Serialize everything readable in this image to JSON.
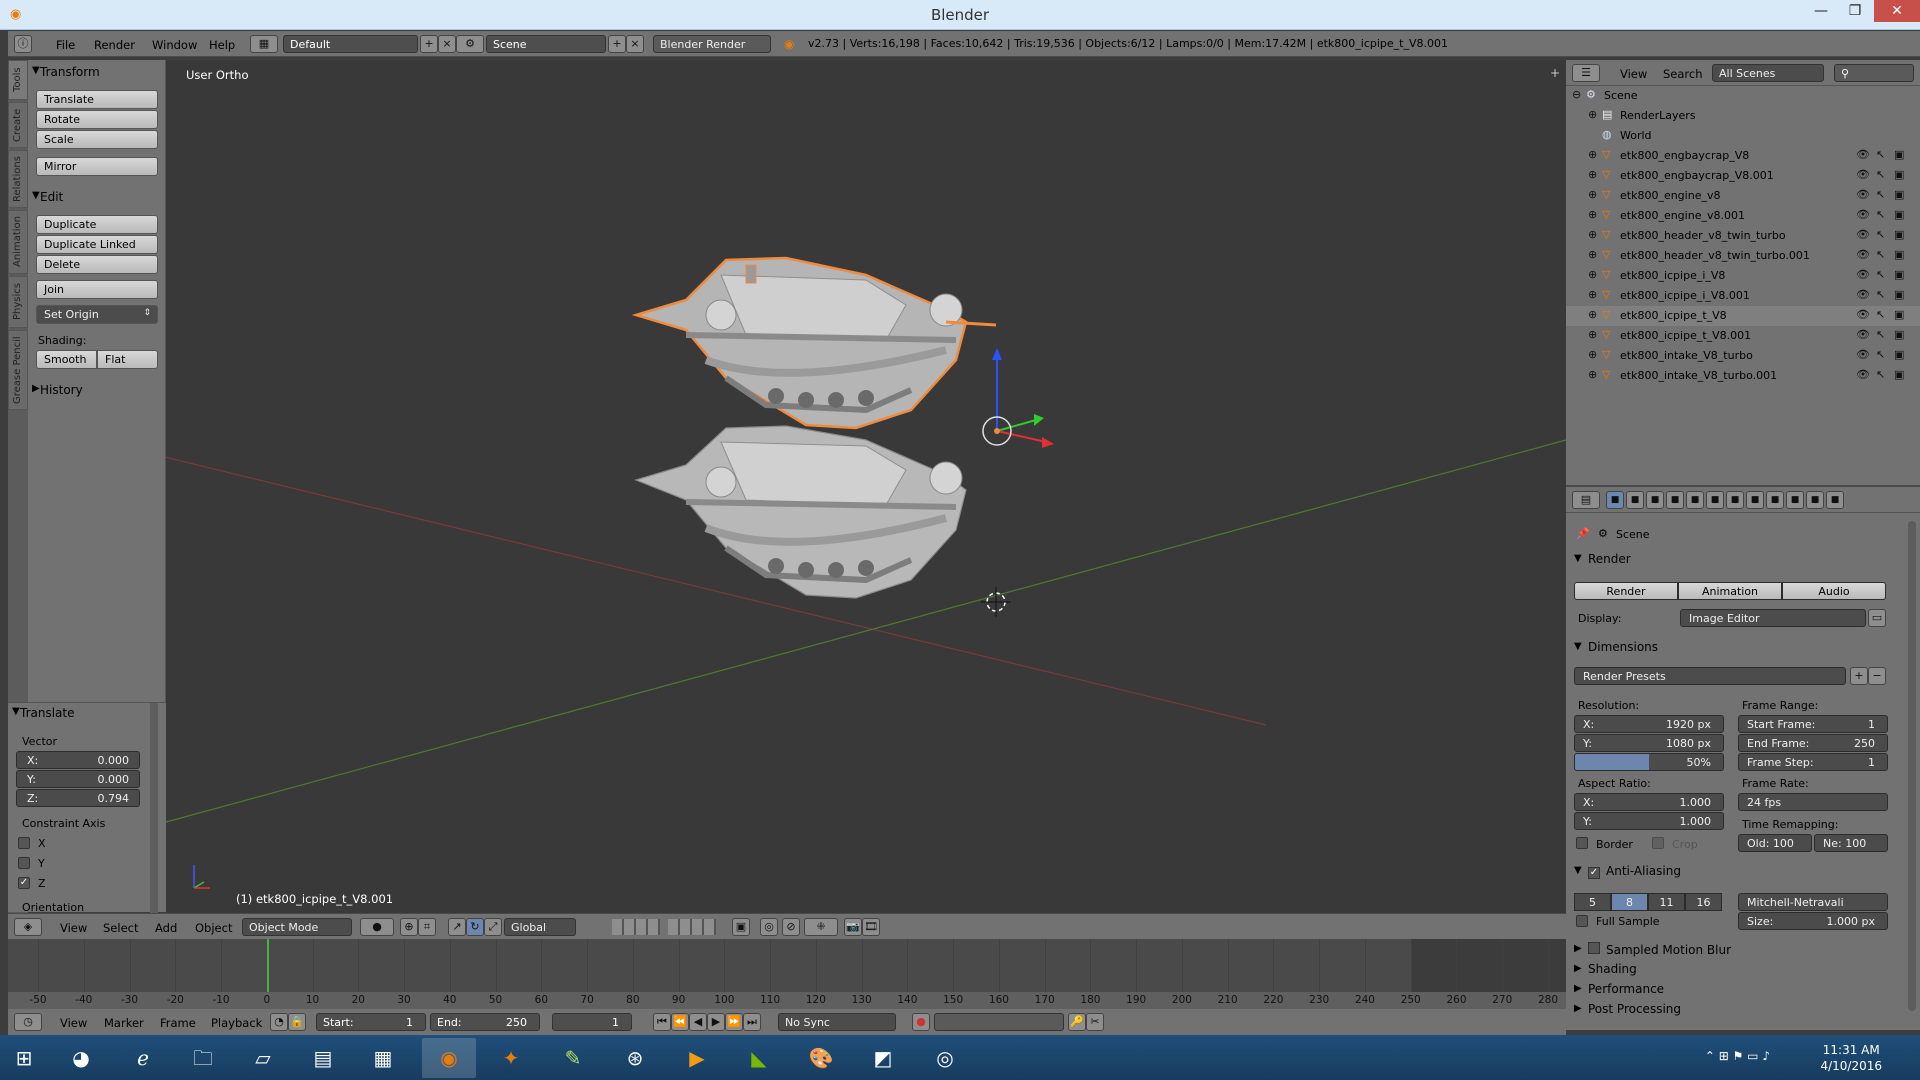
{
  "window": {
    "title": "Blender"
  },
  "info_header": {
    "menus": [
      "File",
      "Render",
      "Window",
      "Help"
    ],
    "layout": "Default",
    "scene": "Scene",
    "engine": "Blender Render",
    "stats": "v2.73 | Verts:16,198 | Faces:10,642 | Tris:19,536 | Objects:6/12 | Lamps:0/0 | Mem:17.42M | etk800_icpipe_t_V8.001"
  },
  "tool_tabs": [
    "Tools",
    "Create",
    "Relations",
    "Animation",
    "Physics",
    "Grease Pencil"
  ],
  "tool_shelf": {
    "transform": {
      "title": "Transform",
      "buttons": [
        "Translate",
        "Rotate",
        "Scale",
        "Mirror"
      ]
    },
    "edit": {
      "title": "Edit",
      "buttons": [
        "Duplicate",
        "Duplicate Linked",
        "Delete",
        "Join"
      ],
      "set_origin": "Set Origin",
      "shading_label": "Shading:",
      "smooth": "Smooth",
      "flat": "Flat"
    },
    "history": {
      "title": "History"
    }
  },
  "operator": {
    "title": "Translate",
    "vector_label": "Vector",
    "x": {
      "label": "X:",
      "value": "0.000"
    },
    "y": {
      "label": "Y:",
      "value": "0.000"
    },
    "z": {
      "label": "Z:",
      "value": "0.794"
    },
    "constraint_label": "Constraint Axis",
    "axes": [
      {
        "label": "X",
        "checked": false
      },
      {
        "label": "Y",
        "checked": false
      },
      {
        "label": "Z",
        "checked": true
      }
    ],
    "orientation_label": "Orientation"
  },
  "viewport": {
    "view_name": "User Ortho",
    "object_label": "(1) etk800_icpipe_t_V8.001"
  },
  "view3d_header": {
    "menus": [
      "View",
      "Select",
      "Add",
      "Object"
    ],
    "mode": "Object Mode",
    "orientation": "Global"
  },
  "outliner": {
    "menus": [
      "View",
      "Search"
    ],
    "scene_filter": "All Scenes",
    "root": "Scene",
    "render_layers": "RenderLayers",
    "world": "World",
    "objects": [
      "etk800_engbaycrap_V8",
      "etk800_engbaycrap_V8.001",
      "etk800_engine_v8",
      "etk800_engine_v8.001",
      "etk800_header_v8_twin_turbo",
      "etk800_header_v8_twin_turbo.001",
      "etk800_icpipe_i_V8",
      "etk800_icpipe_i_V8.001",
      "etk800_icpipe_t_V8",
      "etk800_icpipe_t_V8.001",
      "etk800_intake_V8_turbo",
      "etk800_intake_V8_turbo.001"
    ]
  },
  "properties": {
    "context": "Scene",
    "render": {
      "title": "Render",
      "buttons": [
        "Render",
        "Animation",
        "Audio"
      ],
      "display_label": "Display:",
      "display": "Image Editor"
    },
    "dimensions": {
      "title": "Dimensions",
      "presets": "Render Presets",
      "resolution_label": "Resolution:",
      "res_x": {
        "label": "X:",
        "value": "1920 px"
      },
      "res_y": {
        "label": "Y:",
        "value": "1080 px"
      },
      "res_pct": "50%",
      "frame_range_label": "Frame Range:",
      "start": {
        "label": "Start Frame:",
        "value": "1"
      },
      "end": {
        "label": "End Frame:",
        "value": "250"
      },
      "step": {
        "label": "Frame Step:",
        "value": "1"
      },
      "aspect_label": "Aspect Ratio:",
      "asp_x": {
        "label": "X:",
        "value": "1.000"
      },
      "asp_y": {
        "label": "Y:",
        "value": "1.000"
      },
      "frame_rate_label": "Frame Rate:",
      "fps": "24 fps",
      "time_remap_label": "Time Remapping:",
      "old": "Old: 100",
      "new": "Ne: 100",
      "border": "Border",
      "crop": "Crop"
    },
    "anti_aliasing": {
      "title": "Anti-Aliasing",
      "samples": [
        "5",
        "8",
        "11",
        "16"
      ],
      "selected": "8",
      "filter": "Mitchell-Netravali",
      "full_sample": "Full Sample",
      "size": {
        "label": "Size:",
        "value": "1.000 px"
      }
    },
    "collapsed": [
      "Sampled Motion Blur",
      "Shading",
      "Performance",
      "Post Processing"
    ]
  },
  "timeline": {
    "ticks": [
      "-50",
      "-40",
      "-30",
      "-20",
      "-10",
      "0",
      "10",
      "20",
      "30",
      "40",
      "50",
      "60",
      "70",
      "80",
      "90",
      "100",
      "110",
      "120",
      "130",
      "140",
      "150",
      "160",
      "170",
      "180",
      "190",
      "200",
      "210",
      "220",
      "230",
      "240",
      "250",
      "260",
      "270",
      "280"
    ],
    "current_frame_value": 0,
    "menus": [
      "View",
      "Marker",
      "Frame",
      "Playback"
    ],
    "start": {
      "label": "Start:",
      "value": "1"
    },
    "end": {
      "label": "End:",
      "value": "250"
    },
    "current": "1",
    "sync": "No Sync"
  },
  "taskbar": {
    "time": "11:31 AM",
    "date": "4/10/2016"
  },
  "colors": {
    "accent_orange": "#e87d0d",
    "selection_outline": "#f08a3c",
    "viewport_bg": "#393939",
    "panel_bg": "#727272"
  }
}
